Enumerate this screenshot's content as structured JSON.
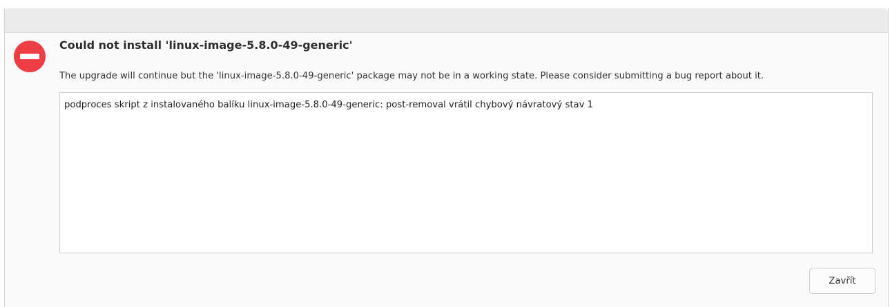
{
  "dialog": {
    "title": "Could not install 'linux-image-5.8.0-49-generic'",
    "message": "The upgrade will continue but the 'linux-image-5.8.0-49-generic' package may not be in a working state. Please consider submitting a bug report about it.",
    "details": "podproces skript z instalovaného balíku linux-image-5.8.0-49-generic: post-removal vrátil chybový návratový stav 1",
    "close_label": "Zavřít",
    "icon": "error-icon",
    "accent_color": "#ef3d46"
  }
}
